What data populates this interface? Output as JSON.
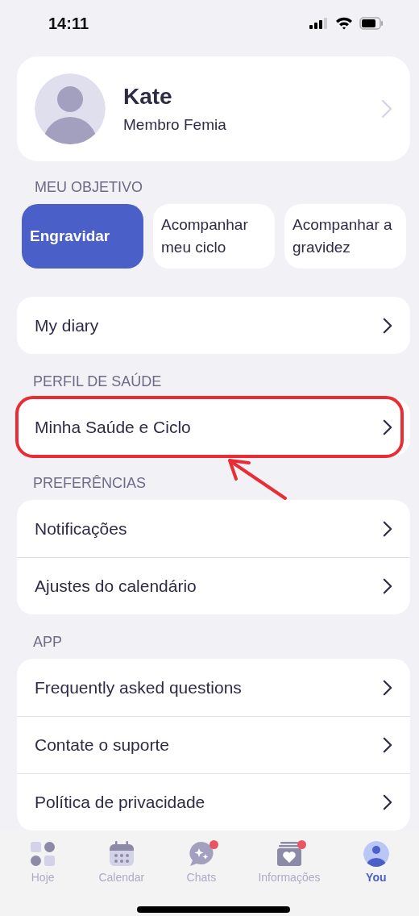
{
  "status_bar": {
    "time": "14:11"
  },
  "profile": {
    "name": "Kate",
    "subtitle": "Membro Femia"
  },
  "goal": {
    "heading": "MEU OBJETIVO",
    "options": [
      {
        "label": "Engravidar",
        "selected": true
      },
      {
        "label": "Acompanhar meu ciclo",
        "selected": false
      },
      {
        "label": "Acompanhar a gravidez",
        "selected": false
      }
    ]
  },
  "sections": [
    {
      "items": [
        {
          "label": "My diary",
          "highlighted": false
        }
      ]
    },
    {
      "heading": "PERFIL DE SAÚDE",
      "items": [
        {
          "label": "Minha Saúde e Ciclo",
          "highlighted": true
        }
      ]
    },
    {
      "heading": "PREFERÊNCIAS",
      "items": [
        {
          "label": "Notificações",
          "highlighted": false
        },
        {
          "label": "Ajustes do calendário",
          "highlighted": false
        }
      ]
    },
    {
      "heading": "APP",
      "items": [
        {
          "label": "Frequently asked questions",
          "highlighted": false
        },
        {
          "label": "Contate o suporte",
          "highlighted": false
        },
        {
          "label": "Política de privacidade",
          "highlighted": false
        }
      ]
    }
  ],
  "tab_bar": [
    {
      "label": "Hoje",
      "selected": false,
      "badge": false
    },
    {
      "label": "Calendar",
      "selected": false,
      "badge": false
    },
    {
      "label": "Chats",
      "selected": false,
      "badge": true
    },
    {
      "label": "Informações",
      "selected": false,
      "badge": true
    },
    {
      "label": "You",
      "selected": true,
      "badge": false
    }
  ]
}
